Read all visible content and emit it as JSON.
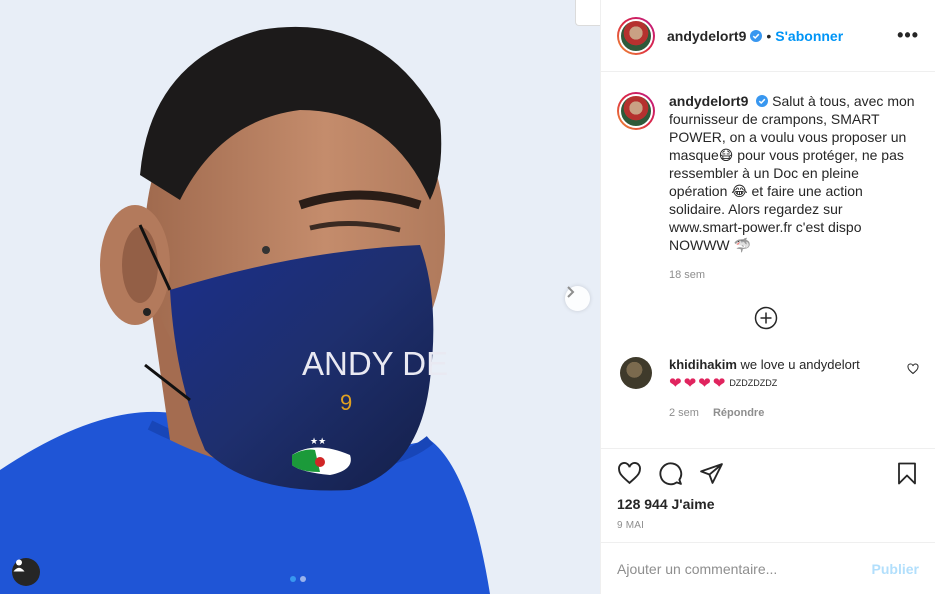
{
  "post": {
    "username": "andydelort9",
    "follow_label": "S'abonner",
    "separator": "•",
    "more_icon": "more-horizontal-icon",
    "caption": "Salut à tous, avec mon fournisseur de crampons, SMART POWER, on a voulu vous proposer un masque😷 pour vous protéger, ne pas ressembler à un Doc en pleine opération 😂 et faire une action solidaire. Alors regardez sur www.smart-power.fr c'est dispo NOWWW 🦈",
    "caption_time": "18 sem",
    "mask_text": "ANDY DE",
    "mask_number": "9"
  },
  "comment": {
    "username": "khidihakim",
    "text": "we love u andydelort",
    "hearts": [
      "❤",
      "❤",
      "❤",
      "❤"
    ],
    "suffix": "DZDZDZDZ",
    "time": "2 sem",
    "reply_label": "Répondre"
  },
  "footer": {
    "likes": "128 944 J'aime",
    "date": "9 MAI",
    "comment_placeholder": "Ajouter un commentaire...",
    "publish_label": "Publier"
  },
  "colors": {
    "accent": "#0095f6",
    "heart": "#e0245e",
    "publish_disabled": "#b2dffc"
  }
}
